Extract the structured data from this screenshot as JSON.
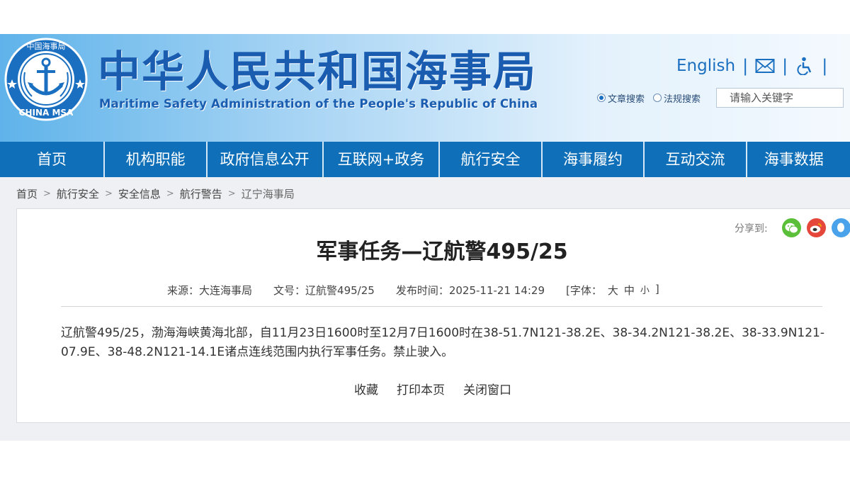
{
  "header": {
    "emblem_text": "CHINA MSA",
    "emblem_top": "中国海事局",
    "title_cn": "中华人民共和国海事局",
    "title_en": "Maritime Safety Administration of the People's Republic of China",
    "top_links": {
      "english": "English",
      "separator": "|"
    },
    "search": {
      "option_article": "文章搜索",
      "option_law": "法规搜索",
      "placeholder": "请输入关键字"
    }
  },
  "nav": {
    "items": [
      {
        "label": "首页"
      },
      {
        "label": "机构职能"
      },
      {
        "label": "政府信息公开"
      },
      {
        "label": "互联网+政务"
      },
      {
        "label": "航行安全"
      },
      {
        "label": "海事履约"
      },
      {
        "label": "互动交流"
      },
      {
        "label": "海事数据"
      }
    ]
  },
  "breadcrumb": {
    "items": [
      "首页",
      "航行安全",
      "安全信息",
      "航行警告",
      "辽宁海事局"
    ],
    "separator": ">"
  },
  "share": {
    "label": "分享到:"
  },
  "article": {
    "title": "军事任务—辽航警495/25",
    "source_label": "来源：",
    "source": "大连海事局",
    "doc_no_label": "文号：",
    "doc_no": "辽航警495/25",
    "publish_label": "发布时间：",
    "publish_time": "2025-11-21 14:29",
    "font_size_label": "[字体：",
    "font_large": "大",
    "font_medium": "中",
    "font_small": "小",
    "font_close": "]",
    "body": "辽航警495/25，渤海海峡黄海北部，自11月23日1600时至12月7日1600时在38-51.7N121-38.2E、38-34.2N121-38.2E、38-33.9N121-07.9E、38-48.2N121-14.1E诸点连线范围内执行军事任务。禁止驶入。",
    "actions": {
      "favorite": "收藏",
      "print": "打印本页",
      "close": "关闭窗口"
    }
  },
  "colors": {
    "brand_blue": "#1a5db0",
    "nav_blue": "#0f6fb8",
    "wechat_green": "#5cbf3a",
    "weibo_red": "#e5473b",
    "qq_blue": "#4aa3ea"
  }
}
